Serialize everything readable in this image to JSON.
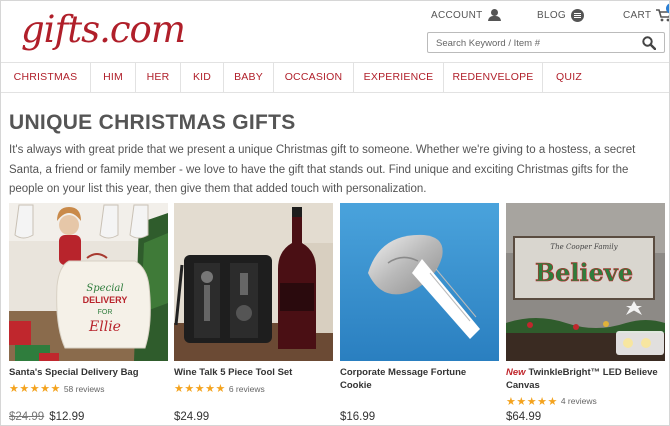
{
  "header": {
    "logo": "gifts.com",
    "account_label": "ACCOUNT",
    "blog_label": "BLOG",
    "cart_label": "CART",
    "cart_count": "0",
    "search_placeholder": "Search Keyword / Item #"
  },
  "nav": {
    "items": [
      "CHRISTMAS",
      "HIM",
      "HER",
      "KID",
      "BABY",
      "OCCASION",
      "EXPERIENCE",
      "REDENVELOPE",
      "QUIZ"
    ]
  },
  "main": {
    "title": "UNIQUE CHRISTMAS GIFTS",
    "intro": "It's always with great pride that we present a unique Christmas gift to someone. Whether we're giving to a hostess, a secret Santa, a friend or family member - we love to have the gift that stands out. Find unique and exciting Christmas gifts for the people on your list this year, then give them that added touch with personalization.",
    "products": [
      {
        "name": "Santa's Special Delivery Bag",
        "new": "",
        "stars": "★★★★★",
        "reviews": "58 reviews",
        "old_price": "$24.99",
        "price": "$12.99",
        "image_text_1": "Special",
        "image_text_2": "DELIVERY",
        "image_text_3": "FOR",
        "image_text_4": "Ellie"
      },
      {
        "name": "Wine Talk 5 Piece Tool Set",
        "new": "",
        "stars": "★★★★★",
        "reviews": "6 reviews",
        "old_price": "",
        "price": "$24.99"
      },
      {
        "name": "Corporate Message Fortune Cookie",
        "new": "",
        "stars": "",
        "reviews": "",
        "old_price": "",
        "price": "$16.99"
      },
      {
        "name": "TwinkleBright™ LED Believe Canvas",
        "new": "New",
        "stars": "★★★★★",
        "reviews": "4 reviews",
        "old_price": "",
        "price": "$64.99",
        "image_text_1": "The Cooper Family",
        "image_text_2": "Believe"
      }
    ]
  },
  "colors": {
    "brand": "#b01f2a",
    "star": "#f4a31e",
    "badge": "#2a7fd4"
  },
  "icons": [
    "user-icon",
    "blog-icon",
    "cart-icon",
    "search-icon"
  ]
}
